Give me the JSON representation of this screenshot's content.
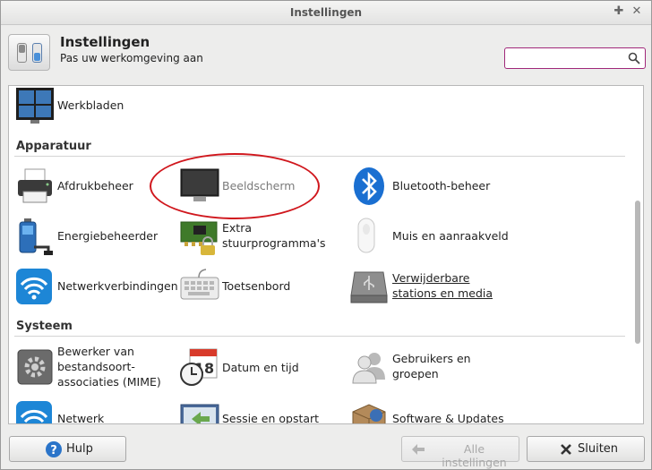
{
  "window": {
    "title": "Instellingen"
  },
  "header": {
    "title": "Instellingen",
    "subtitle": "Pas uw werkomgeving aan",
    "search_placeholder": ""
  },
  "items": {
    "werkbladen": "Werkbladen",
    "afdrukbeheer": "Afdrukbeheer",
    "beeldscherm": "Beeldscherm",
    "bluetooth": "Bluetooth-beheer",
    "energie": "Energiebeheerder",
    "extra1": "Extra",
    "extra2": "stuurprogramma's",
    "muis": "Muis en aanraakveld",
    "netwerkverbindingen": "Netwerkverbindingen",
    "toetsenbord": "Toetsenbord",
    "verwijderbaar1": "Verwijderbare",
    "verwijderbaar2": "stations en media",
    "mime1": "Bewerker van",
    "mime2": "bestandsoort-",
    "mime3": "associaties (MIME)",
    "datum": "Datum en tijd",
    "gebruikers1": "Gebruikers en",
    "gebruikers2": "groepen",
    "netwerk": "Netwerk",
    "sessie": "Sessie en opstart",
    "software": "Software & Updates"
  },
  "sections": {
    "apparatuur": "Apparatuur",
    "systeem": "Systeem"
  },
  "buttons": {
    "help": "Hulp",
    "all_settings": "Alle instellingen",
    "close": "Sluiten"
  },
  "calendar_day": "18"
}
